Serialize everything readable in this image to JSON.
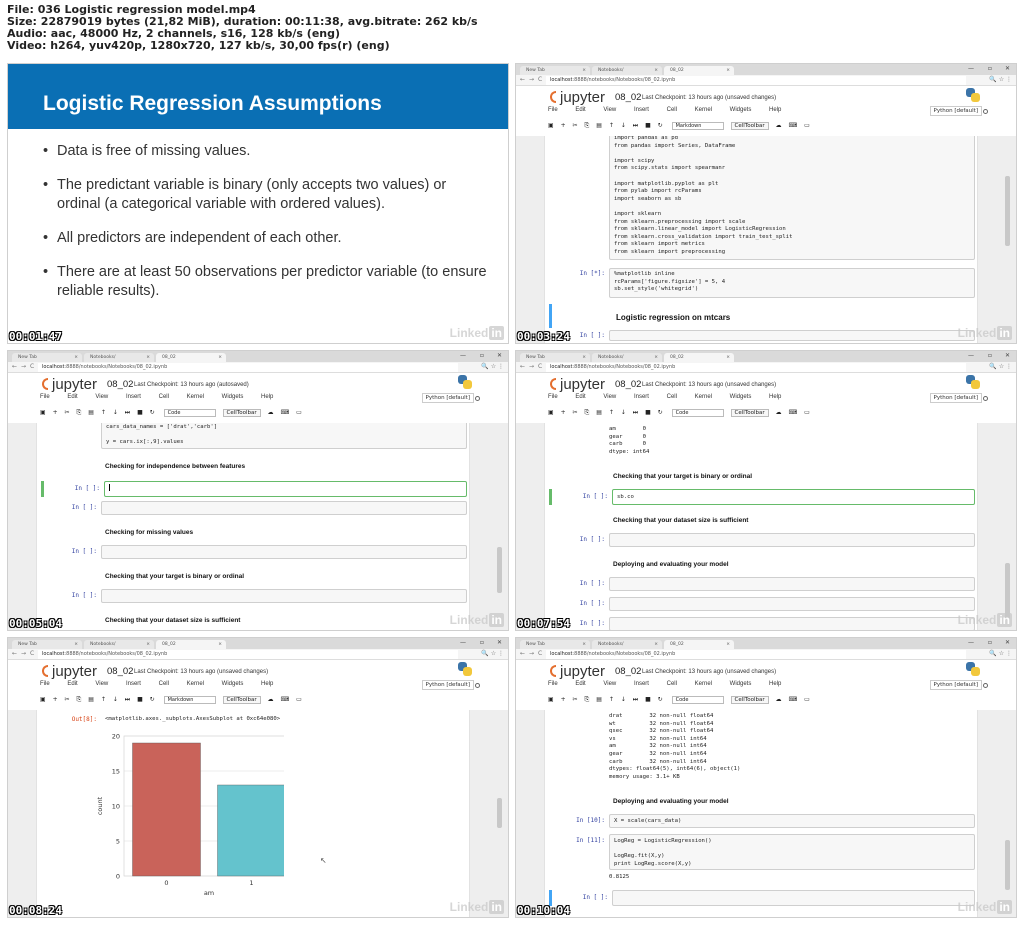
{
  "header": {
    "line1": "File: 036 Logistic regression model.mp4",
    "line2": "Size: 22879019 bytes (21,82 MiB), duration: 00:11:38, avg.bitrate: 262 kb/s",
    "line3": "Audio: aac, 48000 Hz, 2 channels, s16, 128 kb/s (eng)",
    "line4": "Video: h264, yuv420p, 1280x720, 127 kb/s, 30,00 fps(r) (eng)"
  },
  "watermark": "Linked",
  "watermark_in": "in",
  "colors": {
    "slide_band": "#0a6fb4",
    "selected_cell": "#66bb6a",
    "bar_0": "#c9635a",
    "bar_1": "#64c3cd",
    "jupyter_orange": "#e46e2e"
  },
  "browser": {
    "tab1": "New Tab",
    "tab2": "Notebooks/",
    "tab3": "08_02",
    "url_host": "localhost",
    "url_path": ":8888/notebooks/Notebooks/08_02.ipynb",
    "nav": [
      "←",
      "→",
      "C"
    ],
    "win": [
      "—",
      "▫",
      "✕"
    ]
  },
  "jupyter": {
    "brand": "jupyter",
    "notebook": "08_02",
    "checkpoint_unsaved": "Last Checkpoint: 13 hours ago (unsaved changes)",
    "checkpoint_auto": "Last Checkpoint: 13 hours ago (autosaved)",
    "menu": [
      "File",
      "Edit",
      "View",
      "Insert",
      "Cell",
      "Kernel",
      "Widgets",
      "Help"
    ],
    "kernel": "Python [default]",
    "celltype_md": "Markdown",
    "celltype_code": "Code",
    "celltoolbar": "CellToolbar",
    "toolbar_icons": [
      "save-icon",
      "plus-icon",
      "cut-icon",
      "copy-icon",
      "paste-icon",
      "up-icon",
      "down-icon",
      "step-icon",
      "stop-icon",
      "restart-icon"
    ]
  },
  "frames": [
    {
      "time": "00:01:47",
      "slide_title": "Logistic Regression Assumptions",
      "bullets": [
        "Data is free of missing values.",
        "The predictant variable is binary (only accepts two values) or ordinal (a categorical variable with ordered values).",
        "All predictors are independent of each other.",
        "There are at least 50 observations per predictor variable (to ensure reliable results)."
      ]
    },
    {
      "time": "00:03:24",
      "code_imports": "import pandas as pd\nfrom pandas import Series, DataFrame\n\nimport scipy\nfrom scipy.stats import spearmanr\n\nimport matplotlib.pyplot as plt\nfrom pylab import rcParams\nimport seaborn as sb\n\nimport sklearn\nfrom sklearn.preprocessing import scale\nfrom sklearn.linear_model import LogisticRegression\nfrom sklearn.cross_validation import train_test_split\nfrom sklearn import metrics\nfrom sklearn import preprocessing",
      "prompt_star": "In [*]:",
      "code_plot": "%matplotlib inline\nrcParams['figure.figsize'] = 5, 4\nsb.set_style('whitegrid')",
      "heading": "Logistic regression on mtcars",
      "prompt_empty": "In [ ]:"
    },
    {
      "time": "00:05:04",
      "code_top": "cars_data_names = ['drat','carb']\n\ny = cars.ix[:,9].values",
      "md1": "Checking for independence between features",
      "md2": "Checking for missing values",
      "md3": "Checking that your target is binary or ordinal",
      "md4": "Checking that your dataset size is sufficient",
      "prompt_empty": "In [ ]:"
    },
    {
      "time": "00:07:54",
      "out_text": "am        0\ngear      0\ncarb      0\ndtype: int64",
      "md1": "Checking that your target is binary or ordinal",
      "code_sel": "sb.co",
      "md2": "Checking that your dataset size is sufficient",
      "md3": "Deploying and evaluating your model",
      "prompt_empty": "In [ ]:"
    },
    {
      "time": "00:08:24",
      "out_prompt": "Out[8]:",
      "out_text": "<matplotlib.axes._subplots.AxesSubplot at 0xc64e080>"
    },
    {
      "time": "00:10:04",
      "info_text": "drat        32 non-null float64\nwt          32 non-null float64\nqsec        32 non-null float64\nvs          32 non-null int64\nam          32 non-null int64\ngear        32 non-null int64\ncarb        32 non-null int64\ndtypes: float64(5), int64(6), object(1)\nmemory usage: 3.1+ KB",
      "md": "Deploying and evaluating your model",
      "prompt10": "In [10]:",
      "code10": "X = scale(cars_data)",
      "prompt11": "In [11]:",
      "code11": "LogReg = LogisticRegression()\n\nLogReg.fit(X,y)\nprint LogReg.score(X,y)",
      "out11": "0.8125",
      "prompt_empty": "In [ ]:"
    }
  ],
  "chart_data": {
    "type": "bar",
    "categories": [
      "0",
      "1"
    ],
    "values": [
      19,
      13
    ],
    "xlabel": "am",
    "ylabel": "count",
    "ylim": [
      0,
      20
    ],
    "yticks": [
      "0",
      "5",
      "10",
      "15",
      "20"
    ],
    "grid": true
  }
}
